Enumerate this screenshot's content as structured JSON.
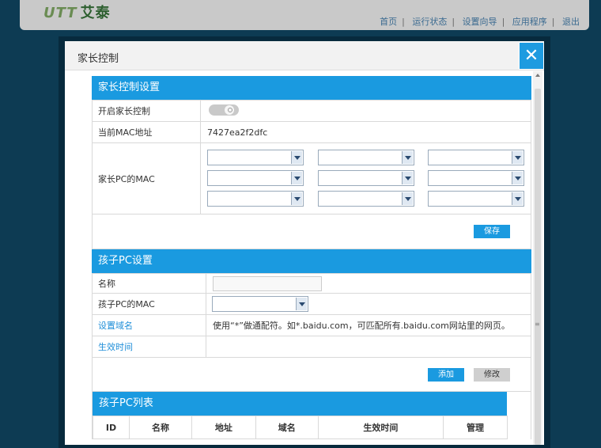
{
  "topbar": {
    "logo_mark": "UTT",
    "logo_text": "艾泰",
    "nav": [
      "首页",
      "运行状态",
      "设置向导",
      "应用程序",
      "退出"
    ]
  },
  "modal": {
    "title": "家长控制",
    "close_icon": "close-icon"
  },
  "parent_settings": {
    "header": "家长控制设置",
    "enable_label": "开启家长控制",
    "enable_state": "off",
    "current_mac_label": "当前MAC地址",
    "current_mac_value": "7427ea2f2dfc",
    "parent_pc_mac_label": "家长PC的MAC",
    "save_label": "保存"
  },
  "child_settings": {
    "header": "孩子PC设置",
    "name_label": "名称",
    "name_value": "",
    "child_mac_label": "孩子PC的MAC",
    "domain_label": "设置域名",
    "domain_hint": "使用“*”做通配符。如*.baidu.com，可匹配所有.baidu.com网站里的网页。",
    "time_label": "生效时间",
    "add_label": "添加",
    "modify_label": "修改"
  },
  "child_list": {
    "header": "孩子PC列表",
    "columns": [
      "ID",
      "名称",
      "地址",
      "域名",
      "生效时间",
      "管理"
    ]
  },
  "colors": {
    "accent": "#1a9ae0",
    "background": "#0d3b53"
  }
}
